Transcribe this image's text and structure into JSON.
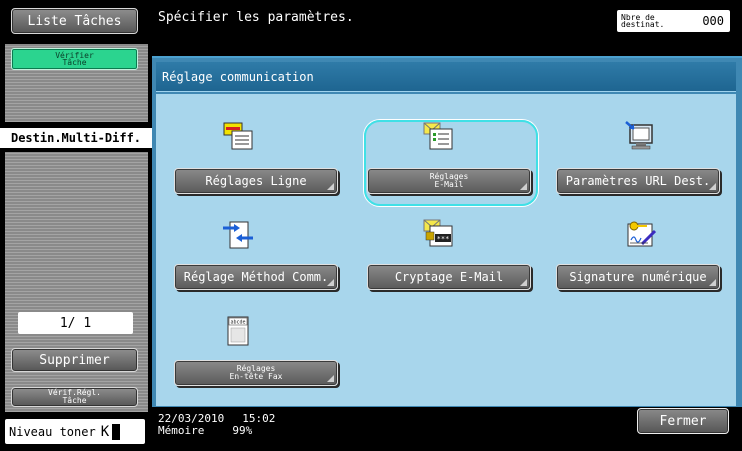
{
  "sidebar": {
    "job_list_label": "Liste Tâches",
    "verify_job_line1": "Vérifier",
    "verify_job_line2": "Tâche",
    "multi_dest_label": "Destin.Multi-Diff.",
    "page_indicator": "1/  1",
    "delete_label": "Supprimer",
    "verify_settings_line1": "Vérif.Régl.",
    "verify_settings_line2": "Tâche",
    "toner_label": "Niveau toner",
    "toner_symbol": "K"
  },
  "header": {
    "message": "Spécifier les paramètres.",
    "dest_count_line1": "Nbre de",
    "dest_count_line2": "destinat.",
    "dest_count_value": "000"
  },
  "panel": {
    "title": "Réglage communication",
    "buttons": {
      "line_settings": "Réglages Ligne",
      "email_settings_line1": "Réglages",
      "email_settings_line2": "E-Mail",
      "url_dest": "Paramètres URL Dest.",
      "comm_method": "Réglage Méthod Comm.",
      "email_encrypt": "Cryptage E-Mail",
      "digital_signature": "Signature numérique",
      "fax_header_line1": "Réglages",
      "fax_header_line2": "En-tête Fax"
    },
    "icon_abcde_text": "abcde",
    "icon_encrypt_text": "***"
  },
  "footer": {
    "date": "22/03/2010",
    "time": "15:02",
    "memory_label": "Mémoire",
    "memory_value": "99%",
    "close_label": "Fermer"
  },
  "icons": {
    "line_settings": "line-settings-icon",
    "email_settings": "email-settings-icon",
    "url_dest": "monitor-url-icon",
    "comm_method": "comm-method-icon",
    "email_encrypt": "email-encrypt-icon",
    "digital_signature": "signature-icon",
    "fax_header": "fax-header-icon"
  },
  "colors": {
    "panel_bg": "#a8d6ec",
    "highlight": "#40e0e6",
    "active_green": "#2bd48f"
  }
}
